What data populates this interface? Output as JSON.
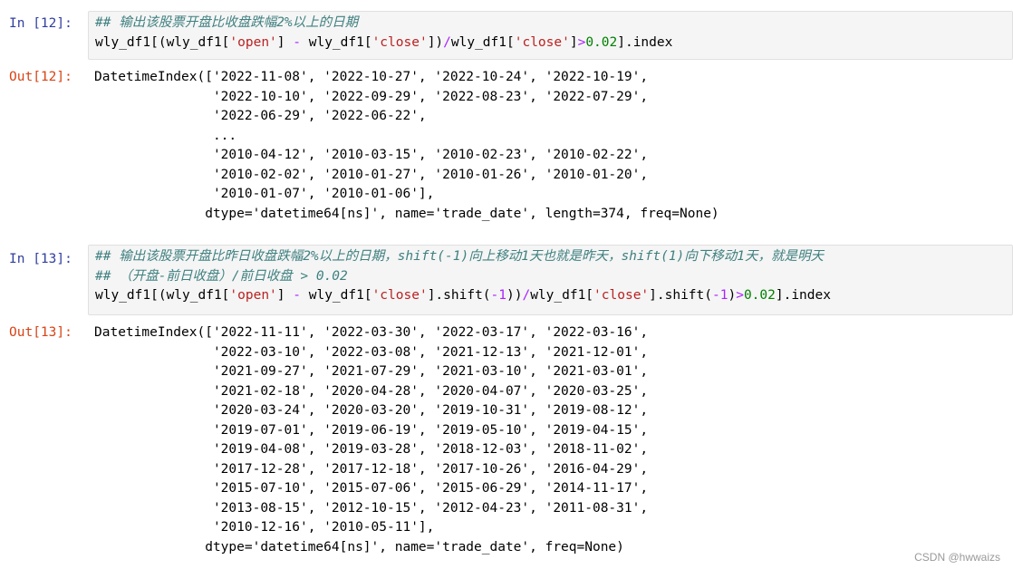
{
  "cells": [
    {
      "in_prompt": "In  [12]:",
      "out_prompt": "Out[12]:",
      "code": {
        "comment1": "## 输出该股票开盘比收盘跌幅2%以上的日期",
        "l2_a": "wly_df1[(wly_df1[",
        "l2_s1": "'open'",
        "l2_b": "] ",
        "l2_minus": "-",
        "l2_c": " wly_df1[",
        "l2_s2": "'close'",
        "l2_d": "])",
        "l2_slash": "/",
        "l2_e": "wly_df1[",
        "l2_s3": "'close'",
        "l2_f": "]",
        "l2_gt": ">",
        "l2_num": "0.02",
        "l2_g": "].index"
      },
      "output_lines": [
        "DatetimeIndex(['2022-11-08', '2022-10-27', '2022-10-24', '2022-10-19',",
        "               '2022-10-10', '2022-09-29', '2022-08-23', '2022-07-29',",
        "               '2022-06-29', '2022-06-22',",
        "               ...",
        "               '2010-04-12', '2010-03-15', '2010-02-23', '2010-02-22',",
        "               '2010-02-02', '2010-01-27', '2010-01-26', '2010-01-20',",
        "               '2010-01-07', '2010-01-06'],",
        "              dtype='datetime64[ns]', name='trade_date', length=374, freq=None)"
      ]
    },
    {
      "in_prompt": "In  [13]:",
      "out_prompt": "Out[13]:",
      "code": {
        "comment1": "## 输出该股票开盘比昨日收盘跌幅2%以上的日期，shift(-1)向上移动1天也就是昨天，shift(1)向下移动1天，就是明天",
        "comment2": "## （开盘-前日收盘）/前日收盘 > 0.02",
        "l3_a": "wly_df1[(wly_df1[",
        "l3_s1": "'open'",
        "l3_b": "] ",
        "l3_minus": "-",
        "l3_c": " wly_df1[",
        "l3_s2": "'close'",
        "l3_d": "].shift(",
        "l3_neg1": "-1",
        "l3_e": "))",
        "l3_slash": "/",
        "l3_f": "wly_df1[",
        "l3_s3": "'close'",
        "l3_g": "].shift(",
        "l3_neg2": "-1",
        "l3_h": ")",
        "l3_gt": ">",
        "l3_num": "0.02",
        "l3_i": "].index"
      },
      "output_lines": [
        "DatetimeIndex(['2022-11-11', '2022-03-30', '2022-03-17', '2022-03-16',",
        "               '2022-03-10', '2022-03-08', '2021-12-13', '2021-12-01',",
        "               '2021-09-27', '2021-07-29', '2021-03-10', '2021-03-01',",
        "               '2021-02-18', '2020-04-28', '2020-04-07', '2020-03-25',",
        "               '2020-03-24', '2020-03-20', '2019-10-31', '2019-08-12',",
        "               '2019-07-01', '2019-06-19', '2019-05-10', '2019-04-15',",
        "               '2019-04-08', '2019-03-28', '2018-12-03', '2018-11-02',",
        "               '2017-12-28', '2017-12-18', '2017-10-26', '2016-04-29',",
        "               '2015-07-10', '2015-07-06', '2015-06-29', '2014-11-17',",
        "               '2013-08-15', '2012-10-15', '2012-04-23', '2011-08-31',",
        "               '2010-12-16', '2010-05-11'],",
        "              dtype='datetime64[ns]', name='trade_date', freq=None)"
      ]
    }
  ],
  "watermark": "CSDN @hwwaizs",
  "colors": {
    "in_prompt": "#303f9f",
    "out_prompt": "#d84315",
    "comment": "#408080",
    "string": "#ba2121",
    "number": "#008000",
    "operator": "#aa22ff",
    "input_bg": "#f5f5f5"
  }
}
